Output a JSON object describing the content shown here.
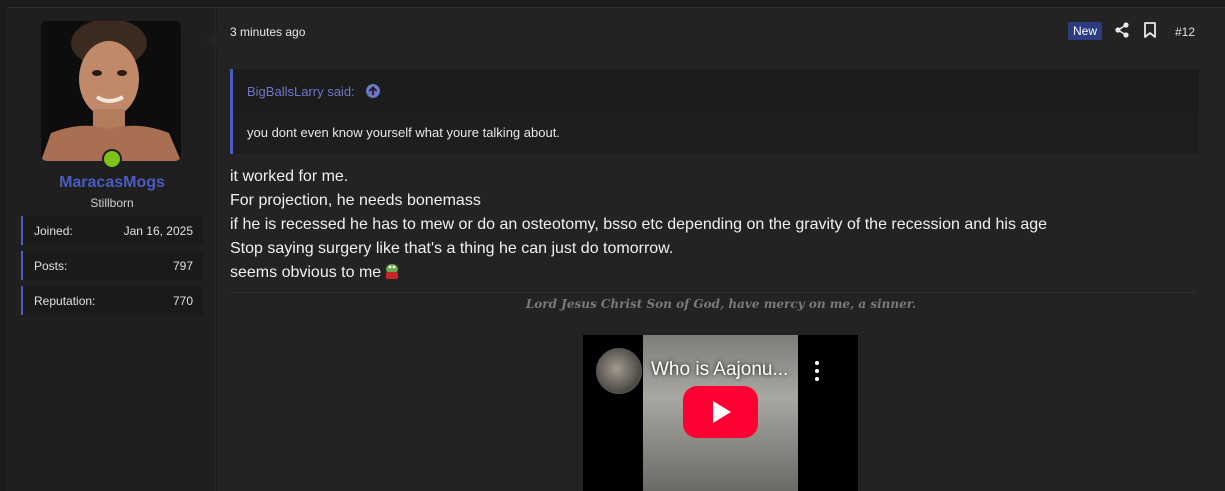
{
  "user": {
    "name": "MaracasMogs",
    "title": "Stillborn",
    "stats": [
      {
        "label": "Joined:",
        "value": "Jan 16, 2025"
      },
      {
        "label": "Posts:",
        "value": "797"
      },
      {
        "label": "Reputation:",
        "value": "770"
      }
    ],
    "online_color": "#7fc21a"
  },
  "post": {
    "time": "3 minutes ago",
    "badge": "New",
    "number": "#12",
    "quote": {
      "author": "BigBallsLarry said:",
      "text": "you dont even know yourself what youre talking about."
    },
    "lines": [
      "it worked for me.",
      "For projection, he needs bonemass",
      "if he is recessed he has to mew or do an osteotomy, bsso etc depending on the gravity of the recession and his age",
      "Stop saying surgery like that's a thing he can just do tomorrow.",
      "seems obvious to me"
    ],
    "signature": "Lord Jesus Christ Son of God, have mercy on me, a sinner.",
    "video": {
      "title": "Who is Aajonu..."
    }
  },
  "colors": {
    "accent": "#4b5bc0",
    "badge_bg": "#2d3c80",
    "play_red": "#ff0033"
  }
}
